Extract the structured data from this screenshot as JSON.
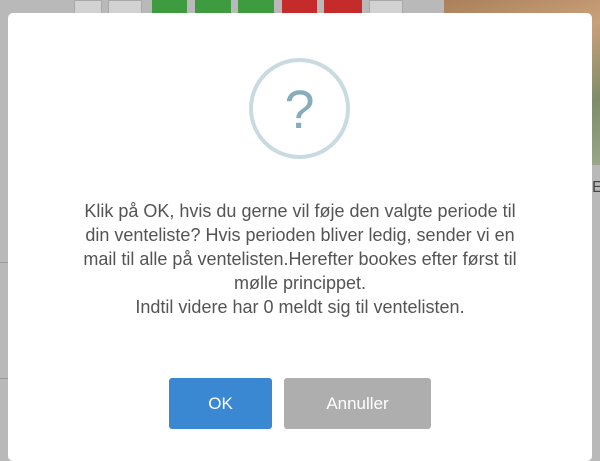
{
  "dialog": {
    "icon": "question-mark-icon",
    "icon_glyph": "?",
    "message_lines": [
      "Klik på OK, hvis du gerne vil føje den valgte periode til",
      "din venteliste? Hvis perioden bliver ledig, sender vi en",
      "mail til alle på ventelisten.Herefter bookes efter først til",
      "mølle princippet.",
      "Indtil videre har 0 meldt sig til ventelisten."
    ],
    "ok_label": "OK",
    "cancel_label": "Annuller"
  },
  "background": {
    "edge_char": "E"
  },
  "colors": {
    "ok_button": "#3a87d2",
    "cancel_button": "#aeaeae",
    "icon_ring": "#c9dae1",
    "icon_glyph": "#87adbd",
    "text": "#545454",
    "overlay": "#b9b9b9"
  }
}
